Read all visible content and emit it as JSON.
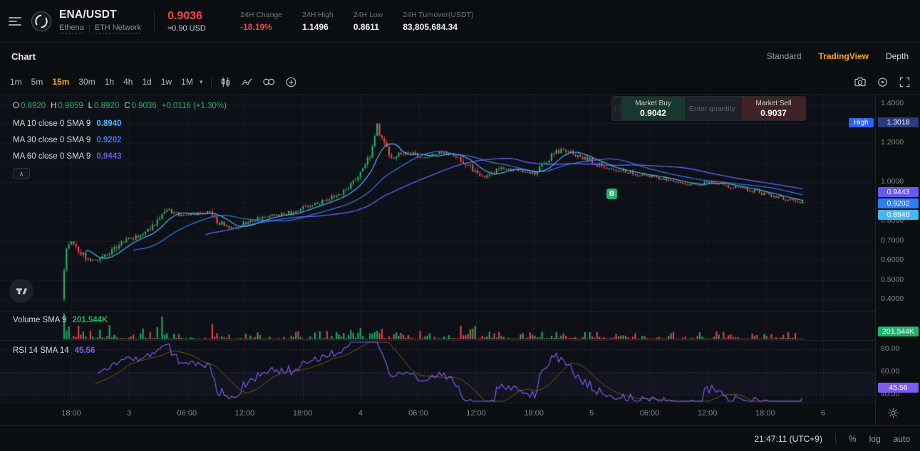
{
  "topbar": {
    "symbol": "ENA/USDT",
    "token_name": "Ethena",
    "network": "ETH Network",
    "last_price": "0.9036",
    "usd_value": "≈0.90 USD",
    "stats": [
      {
        "label": "24H Change",
        "value": "-18.19%",
        "highlight": "down"
      },
      {
        "label": "24H High",
        "value": "1.1496"
      },
      {
        "label": "24H Low",
        "value": "0.8611"
      },
      {
        "label": "24H Turnover(USDT)",
        "value": "83,805,684.34"
      }
    ]
  },
  "tabs": {
    "title": "Chart",
    "views": [
      "Standard",
      "TradingView",
      "Depth"
    ],
    "active_view": "TradingView"
  },
  "toolbar": {
    "timeframes": [
      "1m",
      "5m",
      "15m",
      "30m",
      "1h",
      "4h",
      "1d",
      "1w",
      "1M"
    ],
    "active_timeframe": "15m"
  },
  "icons": {
    "timeframe_caret": "▾",
    "collapse_chevron": "∧",
    "drag_handle": "⋮⋮"
  },
  "trade_widget": {
    "buy_label": "Market Buy",
    "buy_price": "0.9042",
    "qty_placeholder": "Enter quantity",
    "sell_label": "Market Sell",
    "sell_price": "0.9037"
  },
  "legend": {
    "ohlc": [
      [
        "O",
        "0.8920"
      ],
      [
        "H",
        "0.9059"
      ],
      [
        "L",
        "0.8920"
      ],
      [
        "C",
        "0.9036"
      ]
    ],
    "change": "+0.0116 (+1.30%)",
    "ma": [
      {
        "label": "MA 10 close 0 SMA 9",
        "value": "0.8940",
        "color": "#45b8fc"
      },
      {
        "label": "MA 30 close 0 SMA 9",
        "value": "0.9202",
        "color": "#2d7ff7"
      },
      {
        "label": "MA 60 close 0 SMA 9",
        "value": "0.9443",
        "color": "#6459f0"
      }
    ],
    "volume_label": "Volume SMA 9",
    "volume_value": "201.544K",
    "rsi_label": "RSI 14 SMA 14",
    "rsi_value": "45.56"
  },
  "chart_data": {
    "type": "candlestick",
    "symbol": "ENA/USDT",
    "interval": "15m",
    "panes": [
      "price",
      "volume",
      "rsi"
    ],
    "ohlc_current": {
      "open": 0.892,
      "high": 0.9059,
      "low": 0.892,
      "close": 0.9036,
      "change_pct": "+1.30%"
    },
    "high_marker": {
      "label": "High",
      "price": "1.3018"
    },
    "trade_marker": {
      "text": "B"
    },
    "price_axis_ticks": [
      1.4,
      1.2,
      1.0,
      0.8,
      0.7,
      0.6,
      0.5,
      0.4
    ],
    "rsi_axis_ticks": [
      80,
      60,
      40
    ],
    "time_labels": [
      "18:00",
      "3",
      "06:00",
      "12:00",
      "18:00",
      "4",
      "06:00",
      "12:00",
      "18:00",
      "5",
      "06:00",
      "12:00",
      "18:00",
      "6"
    ],
    "candle_count": 310,
    "seed": 11,
    "price_path_anchors": [
      [
        0,
        0.55
      ],
      [
        1,
        0.66
      ],
      [
        3,
        0.7
      ],
      [
        5,
        0.66
      ],
      [
        9,
        0.62
      ],
      [
        13,
        0.6
      ],
      [
        19,
        0.645
      ],
      [
        25,
        0.7
      ],
      [
        31,
        0.72
      ],
      [
        37,
        0.775
      ],
      [
        43,
        0.862
      ],
      [
        48,
        0.832
      ],
      [
        55,
        0.84
      ],
      [
        60,
        0.845
      ],
      [
        65,
        0.792
      ],
      [
        70,
        0.768
      ],
      [
        78,
        0.8
      ],
      [
        85,
        0.828
      ],
      [
        92,
        0.835
      ],
      [
        100,
        0.868
      ],
      [
        108,
        0.905
      ],
      [
        116,
        0.945
      ],
      [
        123,
        1.02
      ],
      [
        128,
        1.14
      ],
      [
        131,
        1.285
      ],
      [
        133,
        1.21
      ],
      [
        137,
        1.12
      ],
      [
        143,
        1.158
      ],
      [
        150,
        1.128
      ],
      [
        157,
        1.15
      ],
      [
        164,
        1.14
      ],
      [
        171,
        1.062
      ],
      [
        176,
        1.018
      ],
      [
        183,
        1.068
      ],
      [
        190,
        1.06
      ],
      [
        197,
        1.042
      ],
      [
        203,
        1.125
      ],
      [
        208,
        1.168
      ],
      [
        213,
        1.142
      ],
      [
        219,
        1.118
      ],
      [
        226,
        1.072
      ],
      [
        234,
        1.058
      ],
      [
        242,
        1.032
      ],
      [
        250,
        1.02
      ],
      [
        257,
        1.0
      ],
      [
        264,
        0.985
      ],
      [
        271,
        1.0
      ],
      [
        279,
        0.975
      ],
      [
        287,
        0.958
      ],
      [
        295,
        0.934
      ],
      [
        303,
        0.912
      ],
      [
        308,
        0.895
      ],
      [
        309,
        0.9036
      ]
    ],
    "colors": {
      "up": "#20b26c",
      "down": "#ef454a",
      "ma10": "#45b8fc",
      "ma30": "#2d7ff7",
      "ma60": "#6459f0",
      "rsi": "#7e5bef",
      "accent": "#f7a600",
      "high_flag_bg": "#2962ff",
      "high_price_bg": "#2b3b80"
    }
  },
  "footer": {
    "clock": "21:47:11 (UTC+9)",
    "scales": [
      "%",
      "log",
      "auto"
    ]
  }
}
